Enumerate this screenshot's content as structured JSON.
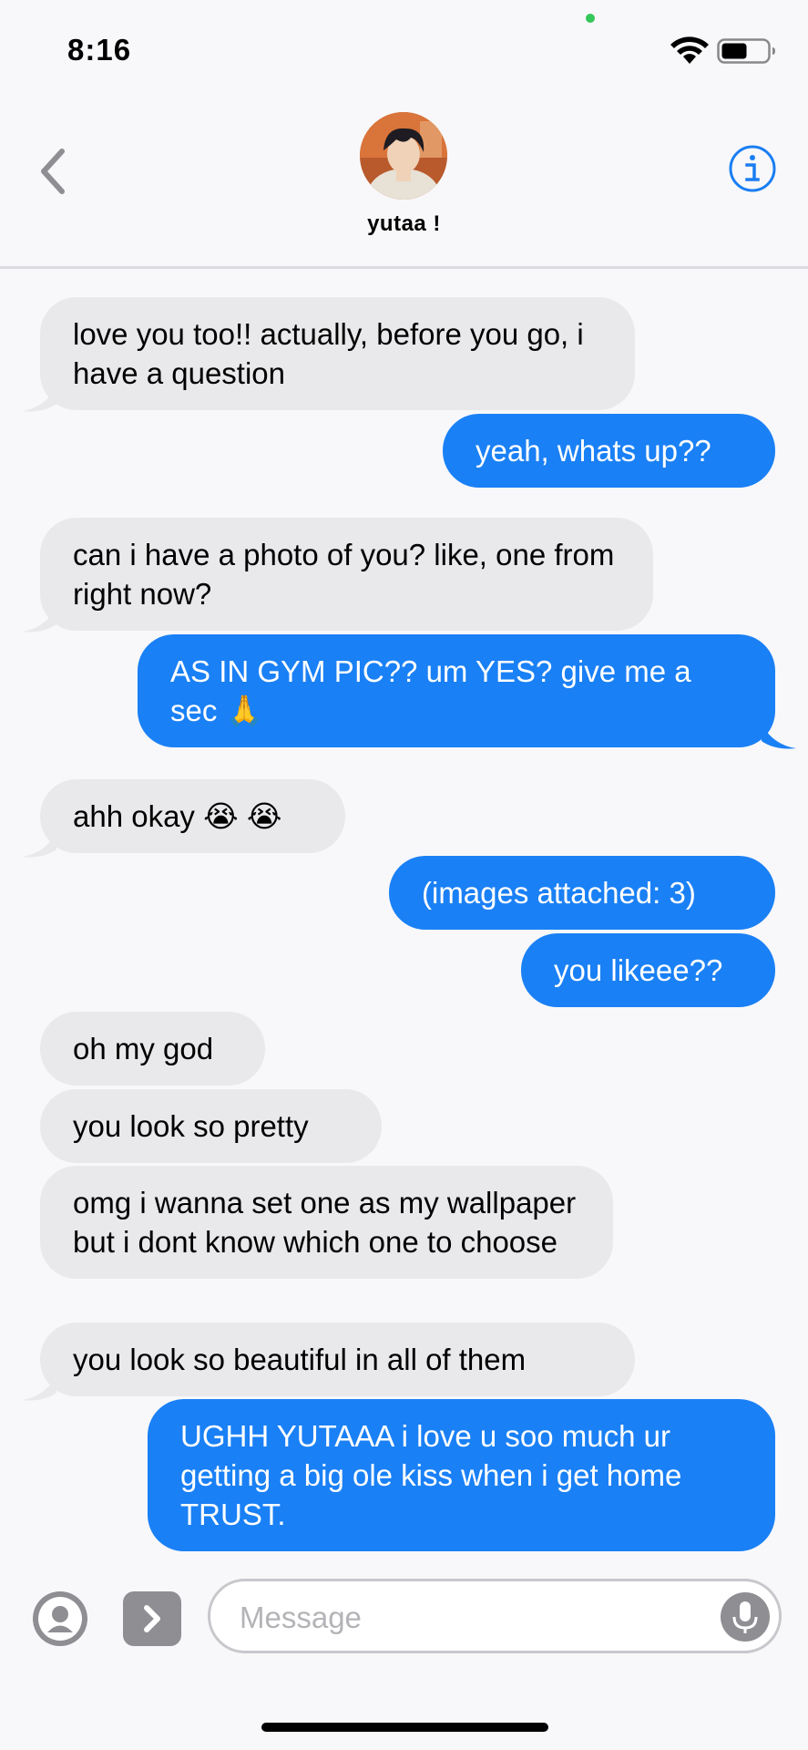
{
  "status_bar": {
    "time": "8:16"
  },
  "header": {
    "contact_name": "yutaa !"
  },
  "messages": [
    {
      "from": "them",
      "text": "love you too!! actually, before you go, i have a question"
    },
    {
      "from": "me",
      "text": "yeah, whats up??"
    },
    {
      "from": "them",
      "text": "can i have a photo of you? like, one from right now?"
    },
    {
      "from": "me",
      "text": "AS IN GYM PIC?? um YES? give me a sec 🙏"
    },
    {
      "from": "them",
      "text": "ahh okay 😭 😭"
    },
    {
      "from": "me",
      "text": "(images attached: 3)"
    },
    {
      "from": "me",
      "text": "you likeee??"
    },
    {
      "from": "them",
      "text": "oh my god"
    },
    {
      "from": "them",
      "text": "you look so pretty"
    },
    {
      "from": "them",
      "text": "omg i wanna set one as my wallpaper but i dont know which one to choose"
    },
    {
      "from": "them",
      "text": "you look so beautiful in all of them"
    },
    {
      "from": "me",
      "text": "UGHH YUTAAA i love u soo much ur getting a big ole kiss when i get home TRUST."
    }
  ],
  "composer": {
    "placeholder": "Message",
    "value": ""
  },
  "colors": {
    "sent_bubble": "#1a80f5",
    "received_bubble": "#e9e9eb",
    "accent": "#1a7ef2"
  },
  "icons": [
    "back-chevron-icon",
    "info-icon",
    "wifi-icon",
    "battery-icon",
    "apps-icon",
    "chevron-right-icon",
    "microphone-icon"
  ]
}
